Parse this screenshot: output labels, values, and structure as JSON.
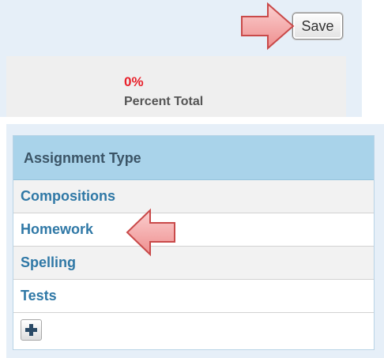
{
  "toolbar": {
    "save_label": "Save"
  },
  "totals": {
    "percent_value": "0%",
    "percent_label": "Percent Total"
  },
  "assignment_types": {
    "header": "Assignment Type",
    "rows": [
      {
        "label": "Compositions"
      },
      {
        "label": "Homework"
      },
      {
        "label": "Spelling"
      },
      {
        "label": "Tests"
      }
    ]
  },
  "colors": {
    "panel_background": "#e6eff8",
    "header_background": "#a9d3ea",
    "link_text": "#2f78a6",
    "percent_value": "#e8202a",
    "callout_arrow": "#f6a9a9"
  },
  "icons": {
    "add": "plus-icon",
    "callout": "arrow-right-icon"
  }
}
